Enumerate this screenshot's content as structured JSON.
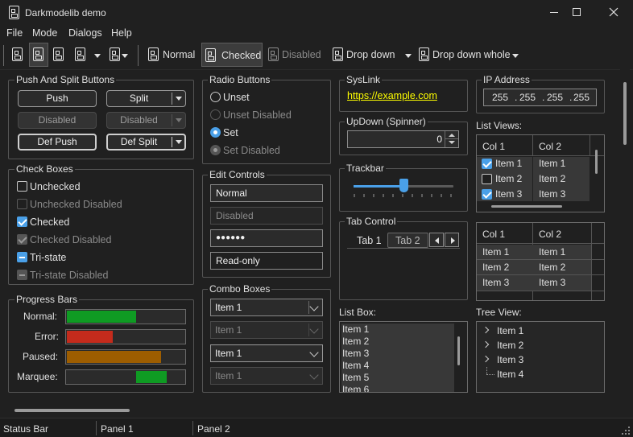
{
  "window": {
    "title": "Darkmodelib demo"
  },
  "menu": [
    "File",
    "Mode",
    "Dialogs",
    "Help"
  ],
  "toolbar": {
    "normal": "Normal",
    "checked": "Checked",
    "disabled": "Disabled",
    "dropdown": "Drop down",
    "dropdown_whole": "Drop down whole"
  },
  "push_split": {
    "title": "Push And Split Buttons",
    "push": "Push",
    "split": "Split",
    "disabled1": "Disabled",
    "disabled2": "Disabled",
    "def_push": "Def Push",
    "def_split": "Def Split"
  },
  "check_boxes": {
    "title": "Check Boxes",
    "unchecked": "Unchecked",
    "unchecked_disabled": "Unchecked Disabled",
    "checked": "Checked",
    "checked_disabled": "Checked Disabled",
    "tristate": "Tri-state",
    "tristate_disabled": "Tri-state Disabled"
  },
  "progress": {
    "title": "Progress Bars",
    "normal_label": "Normal:",
    "error_label": "Error:",
    "paused_label": "Paused:",
    "marquee_label": "Marquee:",
    "normal_value": 0.59,
    "error_value": 0.39,
    "paused_value": 0.8,
    "colors": {
      "normal": "#0f9b23",
      "error": "#c42b1c",
      "paused": "#9d5d00",
      "marquee": "#0f9b23"
    }
  },
  "radio": {
    "title": "Radio Buttons",
    "unset": "Unset",
    "unset_disabled": "Unset Disabled",
    "set": "Set",
    "set_disabled": "Set Disabled"
  },
  "edits": {
    "title": "Edit Controls",
    "normal": "Normal",
    "disabled": "Disabled",
    "password": "●●●●●●",
    "readonly": "Read-only"
  },
  "combos": {
    "title": "Combo Boxes",
    "c1": "Item 1",
    "c2": "Item 1",
    "c3": "Item 1",
    "c4": "Item 1"
  },
  "syslink": {
    "title": "SysLink",
    "link": "https://example.com"
  },
  "updown": {
    "title": "UpDown (Spinner)",
    "value": "0"
  },
  "trackbar": {
    "title": "Trackbar",
    "value": 0.5
  },
  "tabs": {
    "title": "Tab Control",
    "tab1": "Tab 1",
    "tab2": "Tab 2"
  },
  "listbox": {
    "title": "List Box:",
    "items": [
      "Item 1",
      "Item 2",
      "Item 3",
      "Item 4",
      "Item 5",
      "Item 6"
    ]
  },
  "ip": {
    "title": "IP Address",
    "o1": "255",
    "o2": "255",
    "o3": "255",
    "o4": "255",
    "dot": "."
  },
  "listviews": {
    "title": "List Views:",
    "col1": "Col 1",
    "col2": "Col 2",
    "rows1": [
      [
        "Item 1",
        "Item 1"
      ],
      [
        "Item 2",
        "Item 2"
      ],
      [
        "Item 3",
        "Item 3"
      ]
    ],
    "rows2": [
      [
        "Item 1",
        "Item 1"
      ],
      [
        "Item 2",
        "Item 2"
      ],
      [
        "Item 3",
        "Item 3"
      ]
    ]
  },
  "treeview": {
    "title": "Tree View:",
    "items": [
      "Item 1",
      "Item 2",
      "Item 3",
      "Item 4"
    ]
  },
  "statusbar": {
    "s1": "Status Bar",
    "s2": "Panel 1",
    "s3": "Panel 2"
  },
  "colors": {
    "accent": "#4aa0e8",
    "link": "#ffff00",
    "bg": "#202020"
  }
}
